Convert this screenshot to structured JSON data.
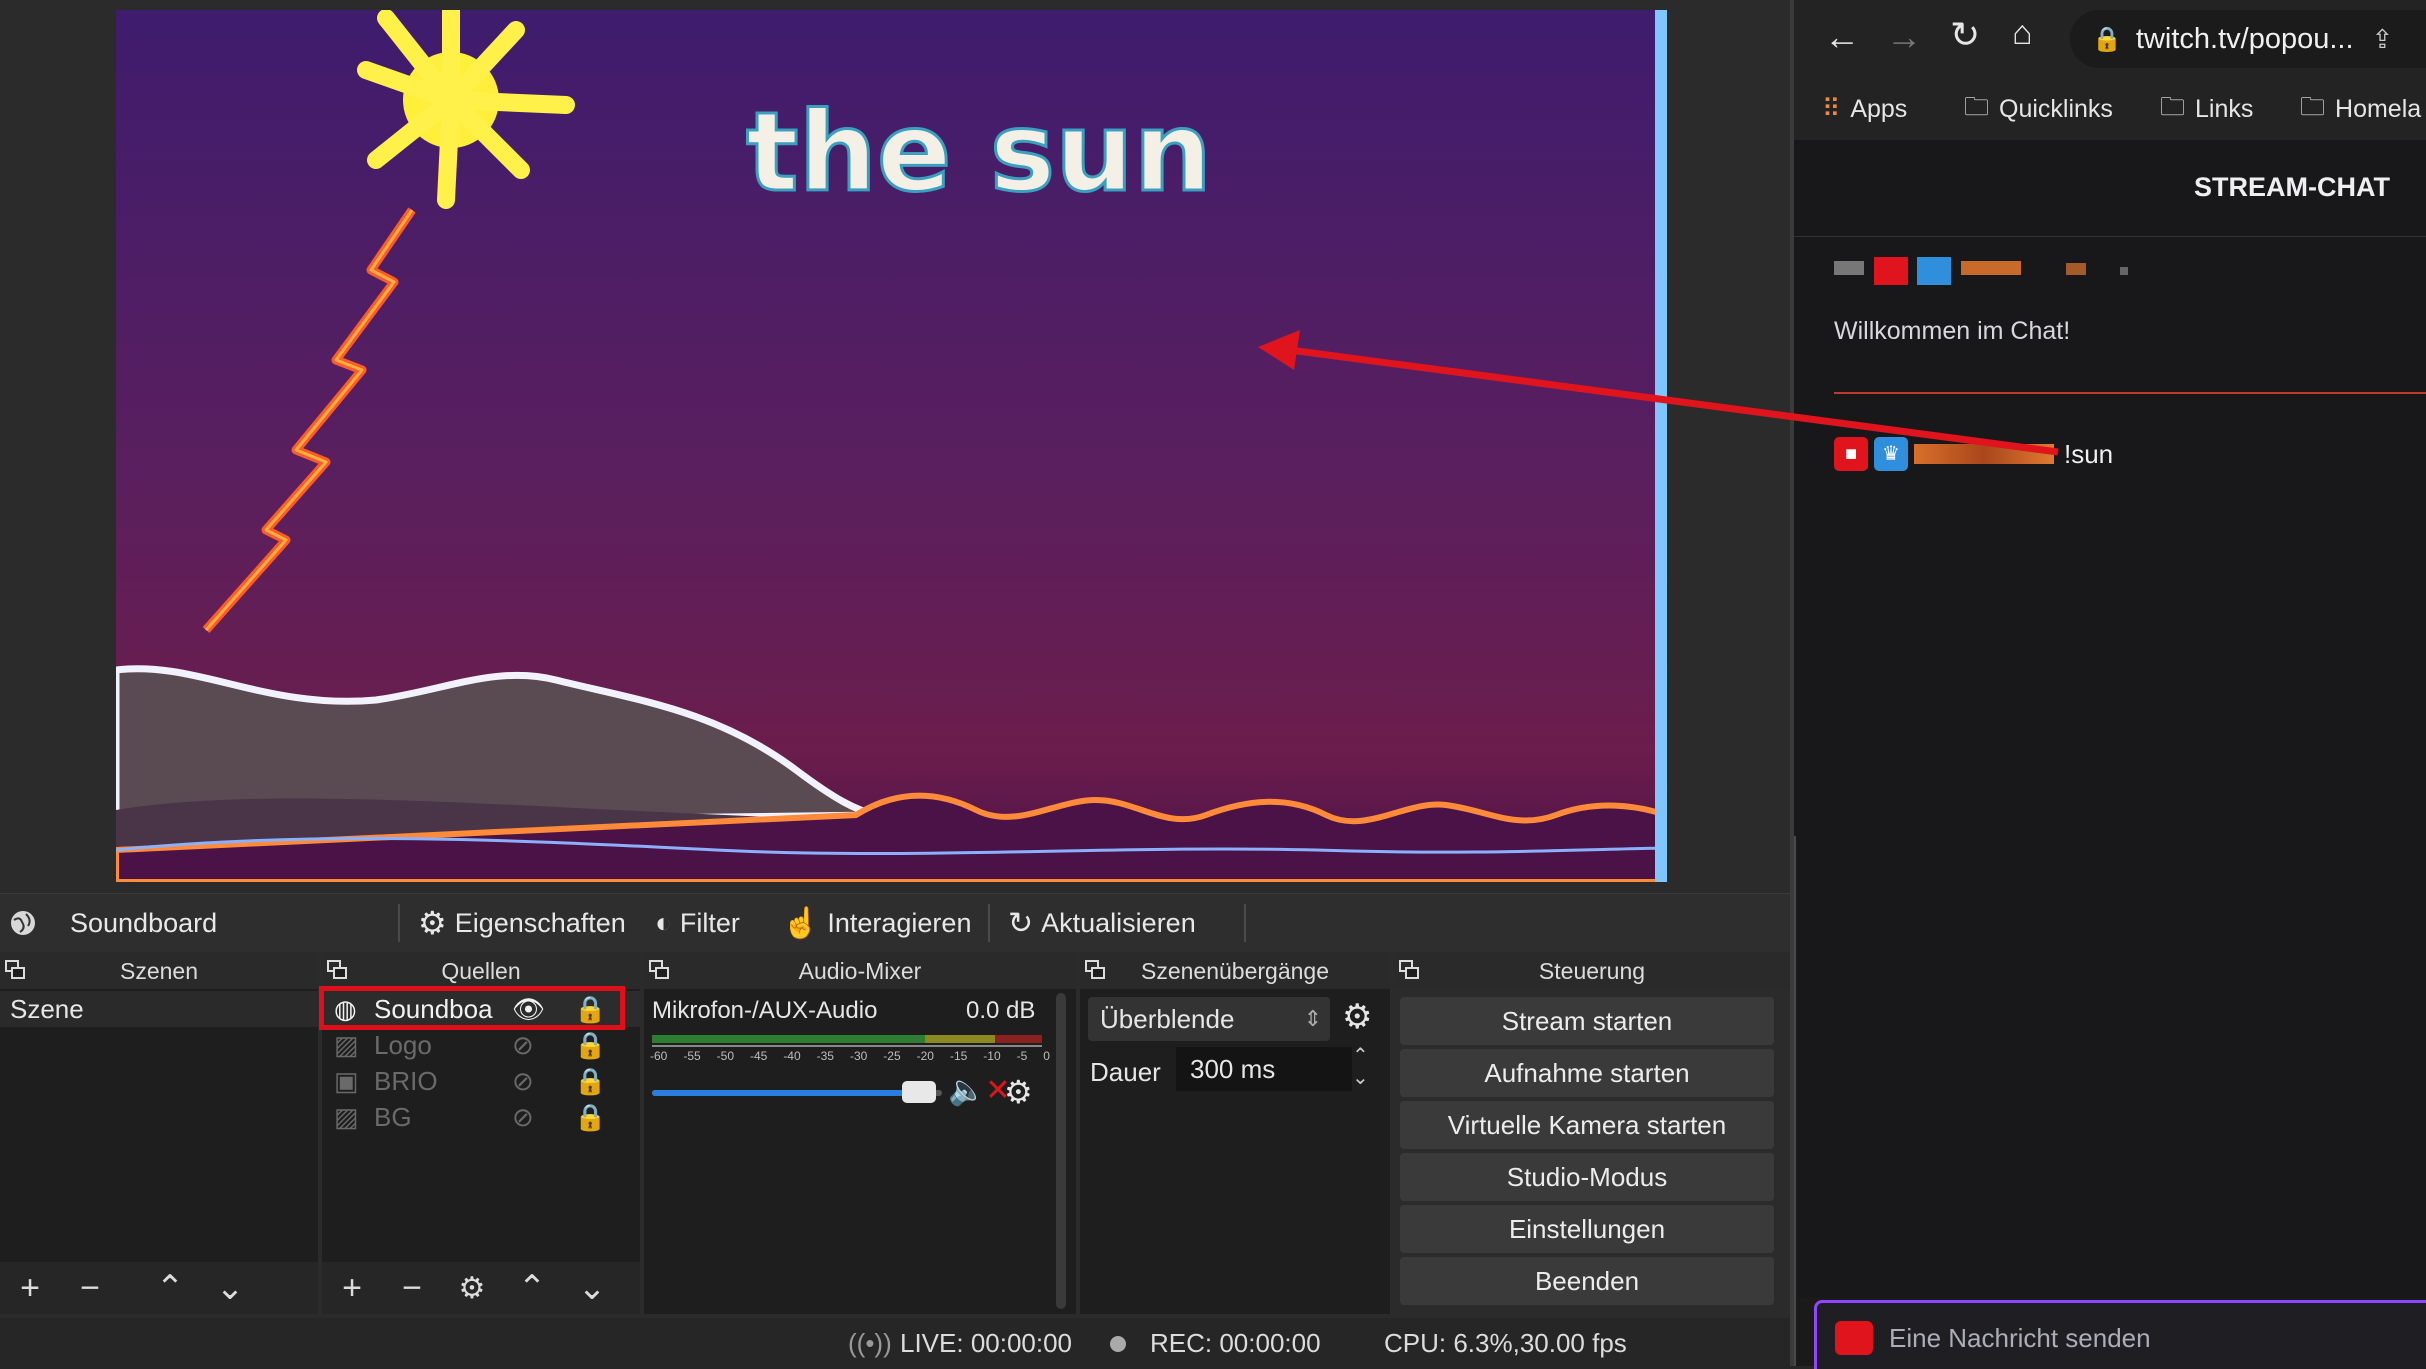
{
  "preview": {
    "title_text": "the sun"
  },
  "toolbar": {
    "source_name": "Soundboard",
    "properties": "Eigenschaften",
    "filter": "Filter",
    "interact": "Interagieren",
    "refresh": "Aktualisieren"
  },
  "docks": {
    "scenes": {
      "title": "Szenen",
      "items": [
        "Szene"
      ]
    },
    "sources": {
      "title": "Quellen",
      "items": [
        "Soundboa",
        "Logo",
        "BRIO",
        "BG"
      ]
    },
    "mixer": {
      "title": "Audio-Mixer",
      "channel": "Mikrofon-/AUX-Audio",
      "level": "0.0 dB",
      "scale": [
        "-60",
        "-55",
        "-50",
        "-45",
        "-40",
        "-35",
        "-30",
        "-25",
        "-20",
        "-15",
        "-10",
        "-5",
        "0"
      ],
      "volume": 0.92
    },
    "transitions": {
      "title": "Szenenübergänge",
      "selected": "Überblende",
      "duration_label": "Dauer",
      "duration_value": "300 ms"
    },
    "controls": {
      "title": "Steuerung",
      "buttons": [
        "Stream starten",
        "Aufnahme starten",
        "Virtuelle Kamera starten",
        "Studio-Modus",
        "Einstellungen",
        "Beenden"
      ]
    }
  },
  "status": {
    "live": "LIVE: 00:00:00",
    "rec": "REC: 00:00:00",
    "cpu": "CPU: 6.3%,30.00 fps"
  },
  "browser": {
    "url": "twitch.tv/popou...",
    "bookmarks": [
      "Apps",
      "Quicklinks",
      "Links",
      "Homela"
    ],
    "chat_title": "STREAM-CHAT",
    "welcome": "Willkommen im Chat!",
    "message": "!sun",
    "input_placeholder": "Eine Nachricht senden"
  },
  "colors": {
    "accent_purple": "#9147ff",
    "highlight_red": "#e0101a",
    "arrow_red": "#e0141c"
  }
}
